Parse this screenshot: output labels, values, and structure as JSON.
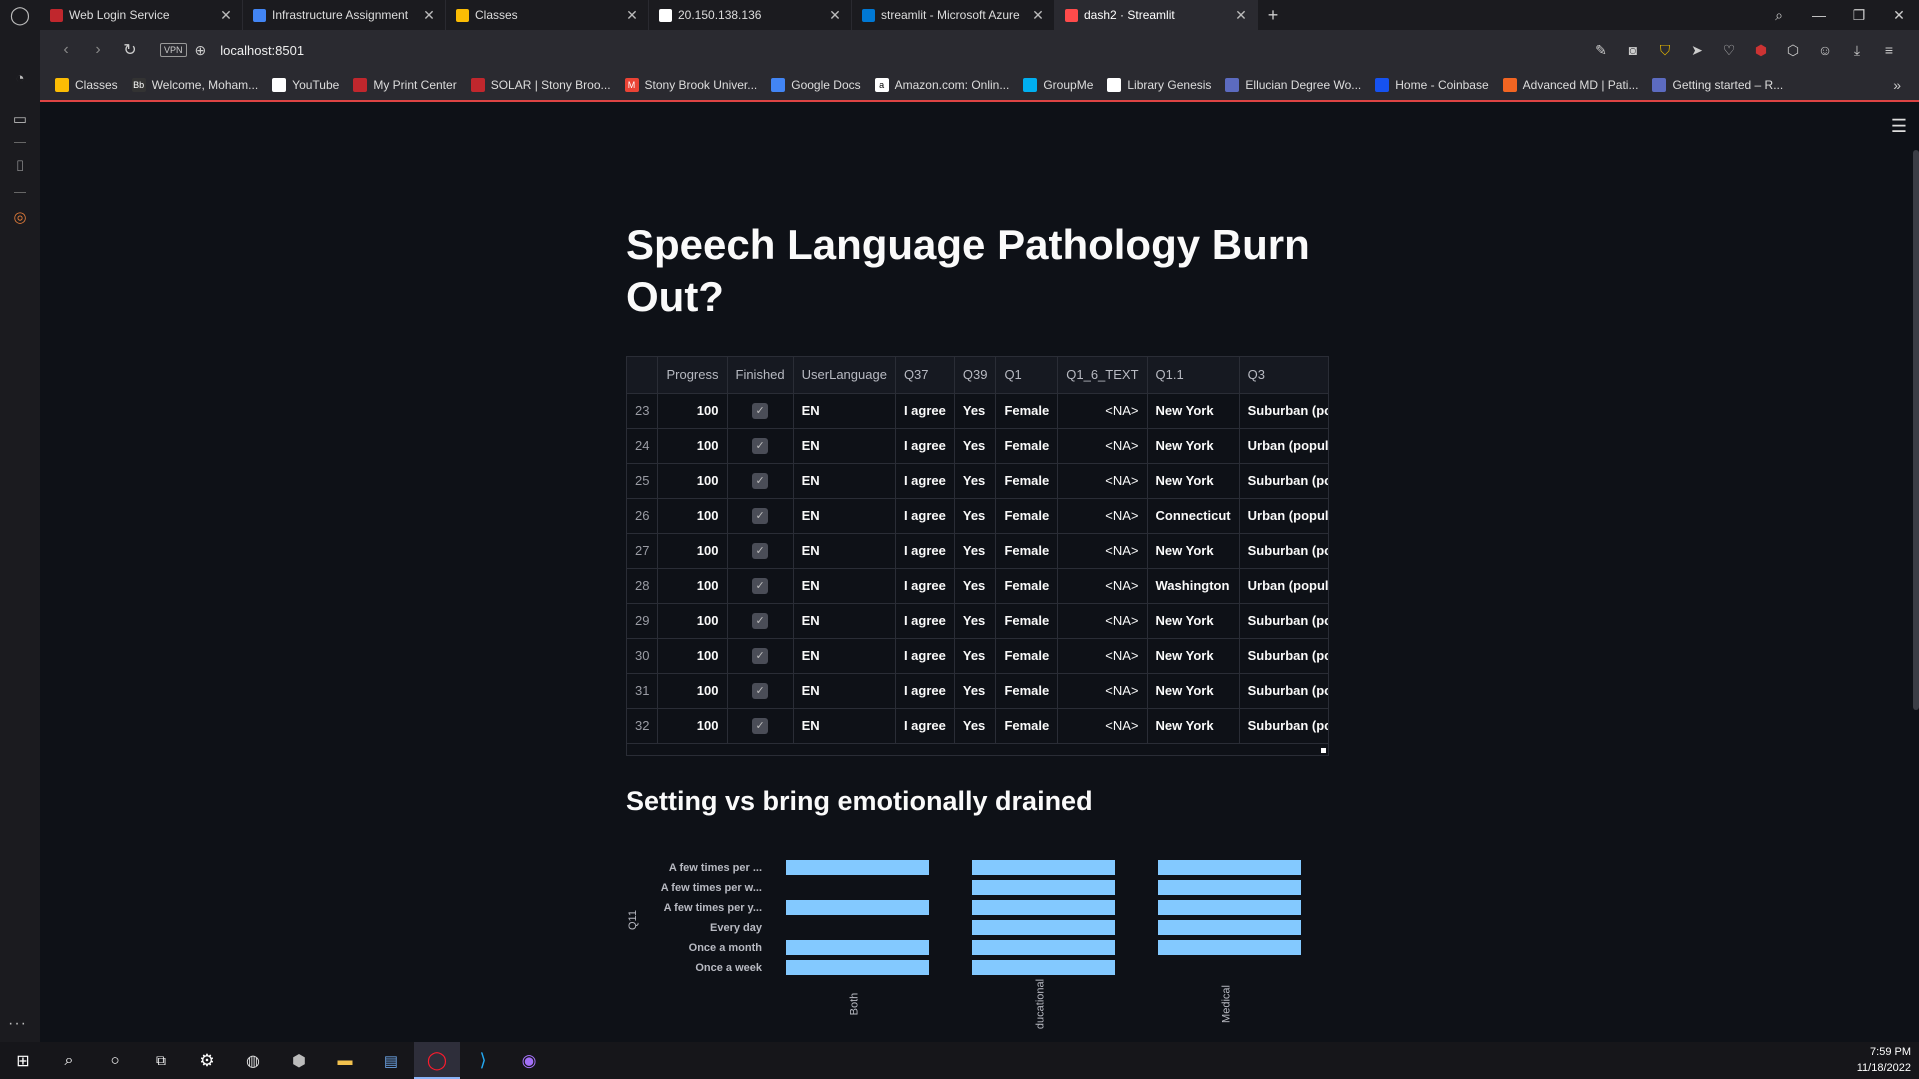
{
  "browser": {
    "tabs": [
      {
        "title": "Web Login Service",
        "icon_color": "#c0272d",
        "active": false
      },
      {
        "title": "Infrastructure Assignment",
        "icon_color": "#4285f4",
        "active": false
      },
      {
        "title": "Classes",
        "icon_color": "#fbbc04",
        "active": false
      },
      {
        "title": "20.150.138.136",
        "icon_color": "#ffffff",
        "active": false
      },
      {
        "title": "streamlit - Microsoft Azure",
        "icon_color": "#0078d4",
        "active": false
      },
      {
        "title": "dash2 · Streamlit",
        "icon_color": "#ff4b4b",
        "active": true
      }
    ],
    "url": "localhost:8501",
    "vpn_label": "VPN",
    "bookmarks": [
      {
        "label": "Classes",
        "icon_color": "#fbbc04"
      },
      {
        "label": "Welcome, Moham...",
        "icon_color": "#333333",
        "icon_text": "Bb"
      },
      {
        "label": "YouTube",
        "icon_color": "#ffffff"
      },
      {
        "label": "My Print Center",
        "icon_color": "#c0272d"
      },
      {
        "label": "SOLAR | Stony Broo...",
        "icon_color": "#c0272d"
      },
      {
        "label": "Stony Brook Univer...",
        "icon_color": "#ea4335",
        "icon_text": "M"
      },
      {
        "label": "Google Docs",
        "icon_color": "#4285f4"
      },
      {
        "label": "Amazon.com: Onlin...",
        "icon_color": "#ffffff",
        "icon_text": "a"
      },
      {
        "label": "GroupMe",
        "icon_color": "#00aff0"
      },
      {
        "label": "Library Genesis",
        "icon_color": "#ffffff"
      },
      {
        "label": "Ellucian Degree Wo...",
        "icon_color": "#5c6bc0"
      },
      {
        "label": "Home - Coinbase",
        "icon_color": "#1652f0"
      },
      {
        "label": "Advanced MD | Pati...",
        "icon_color": "#f26522"
      },
      {
        "label": "Getting started – R...",
        "icon_color": "#5c6bc0"
      }
    ]
  },
  "page": {
    "title": "Speech Language Pathology Burn Out?",
    "subtitle": "Setting vs bring emotionally drained"
  },
  "table": {
    "columns": [
      "",
      "Progress",
      "Finished",
      "UserLanguage",
      "Q37",
      "Q39",
      "Q1",
      "Q1_6_TEXT",
      "Q1.1",
      "Q3"
    ],
    "rows": [
      {
        "idx": "23",
        "progress": "100",
        "finished": true,
        "lang": "EN",
        "q37": "I agree",
        "q39": "Yes",
        "q1": "Female",
        "q1_6": "<NA>",
        "q1_1": "New York",
        "q3": "Suburban (popula"
      },
      {
        "idx": "24",
        "progress": "100",
        "finished": true,
        "lang": "EN",
        "q37": "I agree",
        "q39": "Yes",
        "q1": "Female",
        "q1_6": "<NA>",
        "q1_1": "New York",
        "q3": "Urban (population"
      },
      {
        "idx": "25",
        "progress": "100",
        "finished": true,
        "lang": "EN",
        "q37": "I agree",
        "q39": "Yes",
        "q1": "Female",
        "q1_6": "<NA>",
        "q1_1": "New York",
        "q3": "Suburban (popula"
      },
      {
        "idx": "26",
        "progress": "100",
        "finished": true,
        "lang": "EN",
        "q37": "I agree",
        "q39": "Yes",
        "q1": "Female",
        "q1_6": "<NA>",
        "q1_1": "Connecticut",
        "q3": "Urban (population"
      },
      {
        "idx": "27",
        "progress": "100",
        "finished": true,
        "lang": "EN",
        "q37": "I agree",
        "q39": "Yes",
        "q1": "Female",
        "q1_6": "<NA>",
        "q1_1": "New York",
        "q3": "Suburban (popula"
      },
      {
        "idx": "28",
        "progress": "100",
        "finished": true,
        "lang": "EN",
        "q37": "I agree",
        "q39": "Yes",
        "q1": "Female",
        "q1_6": "<NA>",
        "q1_1": "Washington",
        "q3": "Urban (population"
      },
      {
        "idx": "29",
        "progress": "100",
        "finished": true,
        "lang": "EN",
        "q37": "I agree",
        "q39": "Yes",
        "q1": "Female",
        "q1_6": "<NA>",
        "q1_1": "New York",
        "q3": "Suburban (popula"
      },
      {
        "idx": "30",
        "progress": "100",
        "finished": true,
        "lang": "EN",
        "q37": "I agree",
        "q39": "Yes",
        "q1": "Female",
        "q1_6": "<NA>",
        "q1_1": "New York",
        "q3": "Suburban (popula"
      },
      {
        "idx": "31",
        "progress": "100",
        "finished": true,
        "lang": "EN",
        "q37": "I agree",
        "q39": "Yes",
        "q1": "Female",
        "q1_6": "<NA>",
        "q1_1": "New York",
        "q3": "Suburban (popula"
      },
      {
        "idx": "32",
        "progress": "100",
        "finished": true,
        "lang": "EN",
        "q37": "I agree",
        "q39": "Yes",
        "q1": "Female",
        "q1_6": "<NA>",
        "q1_1": "New York",
        "q3": "Suburban (popula"
      }
    ]
  },
  "chart_data": {
    "type": "bar",
    "orientation": "horizontal",
    "faceted": true,
    "ylabel": "Q11",
    "categories": [
      "A few times per ...",
      "A few times per w...",
      "A few times per y...",
      "Every day",
      "Once a month",
      "Once a week"
    ],
    "facets": [
      {
        "name": "Both",
        "values": [
          1,
          0,
          1,
          0,
          1,
          1
        ]
      },
      {
        "name": "Educational",
        "visible_label": "ducational",
        "values": [
          1,
          1,
          1,
          1,
          1,
          1
        ]
      },
      {
        "name": "Medical",
        "values": [
          1,
          1,
          1,
          1,
          1,
          0
        ]
      }
    ],
    "bar_color": "#83c9ff",
    "xlim": [
      0,
      1
    ]
  },
  "taskbar": {
    "time": "7:59 PM",
    "date": "11/18/2022"
  },
  "colors": {
    "background": "#0e1117",
    "chrome": "#1b1b1f",
    "accent": "#ff4b4b"
  }
}
